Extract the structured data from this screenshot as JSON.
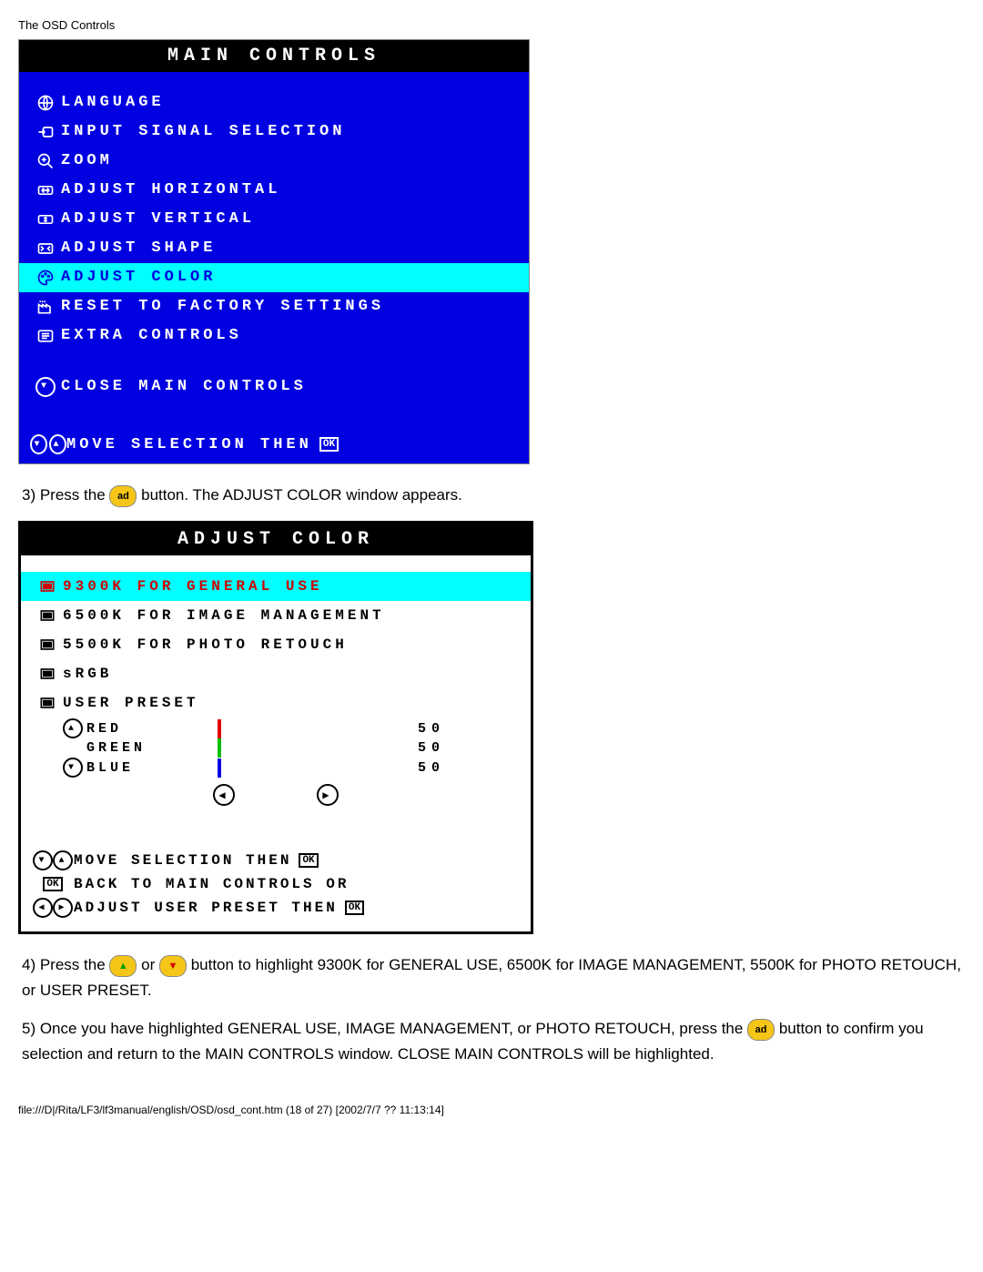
{
  "header": "The OSD Controls",
  "main_controls": {
    "title": "MAIN CONTROLS",
    "items": [
      {
        "label": "LANGUAGE"
      },
      {
        "label": "INPUT SIGNAL SELECTION"
      },
      {
        "label": "ZOOM"
      },
      {
        "label": "ADJUST HORIZONTAL"
      },
      {
        "label": "ADJUST VERTICAL"
      },
      {
        "label": "ADJUST SHAPE"
      },
      {
        "label": "ADJUST COLOR"
      },
      {
        "label": "RESET TO FACTORY SETTINGS"
      },
      {
        "label": "EXTRA CONTROLS"
      }
    ],
    "close": "CLOSE MAIN CONTROLS",
    "hint": "MOVE SELECTION THEN",
    "ok": "OK"
  },
  "step3": {
    "prefix": "3) Press the ",
    "btn": "ad",
    "suffix": " button. The ADJUST COLOR window appears."
  },
  "adjust_color": {
    "title": "ADJUST COLOR",
    "items": [
      {
        "label": "9300K FOR GENERAL USE"
      },
      {
        "label": "6500K FOR IMAGE MANAGEMENT"
      },
      {
        "label": "5500K FOR PHOTO RETOUCH"
      },
      {
        "label": "sRGB"
      },
      {
        "label": "USER PRESET"
      }
    ],
    "presets": {
      "red": {
        "label": "RED",
        "value": "50"
      },
      "green": {
        "label": "GREEN",
        "value": "50"
      },
      "blue": {
        "label": "BLUE",
        "value": "50"
      }
    },
    "hint1": "MOVE SELECTION THEN",
    "hint2": "BACK TO MAIN CONTROLS OR",
    "hint3": "ADJUST USER PRESET THEN",
    "ok": "OK"
  },
  "step4": "4) Press the ",
  "step4_mid": " or ",
  "step4_end": " button to highlight 9300K for GENERAL USE, 6500K for IMAGE MANAGEMENT, 5500K for PHOTO RETOUCH, or USER PRESET.",
  "step5a": "5) Once you have highlighted GENERAL USE, IMAGE MANAGEMENT, or PHOTO RETOUCH, press the ",
  "step5b": " button to confirm you selection and return to the MAIN CONTROLS window. CLOSE MAIN CONTROLS will be highlighted.",
  "footer_path": "file:///D|/Rita/LF3/lf3manual/english/OSD/osd_cont.htm (18 of 27) [2002/7/7 ?? 11:13:14]"
}
